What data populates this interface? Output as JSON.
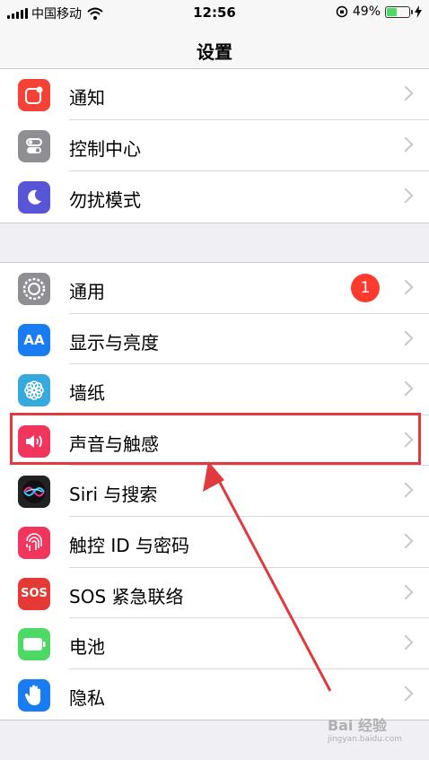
{
  "status_bar": {
    "carrier": "中国移动",
    "time": "12:56",
    "battery_pct": "49%",
    "battery_level": 0.49
  },
  "nav": {
    "title": "设置"
  },
  "group1": [
    {
      "label": "通知",
      "icon": "notifications-icon",
      "color": "#f44336"
    },
    {
      "label": "控制中心",
      "icon": "control-center-icon",
      "color": "#8e8e93"
    },
    {
      "label": "勿扰模式",
      "icon": "moon-icon",
      "color": "#5856d6"
    }
  ],
  "group2": [
    {
      "label": "通用",
      "icon": "gear-icon",
      "color": "#8e8e93",
      "badge": "1"
    },
    {
      "label": "显示与亮度",
      "icon": "display-icon",
      "color": "#1a7cf2",
      "glyph": "AA"
    },
    {
      "label": "墙纸",
      "icon": "wallpaper-icon",
      "color": "#36aadc"
    },
    {
      "label": "声音与触感",
      "icon": "speaker-icon",
      "color": "#f2355c"
    },
    {
      "label": "Siri 与搜索",
      "icon": "siri-icon",
      "color": "#222"
    },
    {
      "label": "触控 ID 与密码",
      "icon": "fingerprint-icon",
      "color": "#f2355c"
    },
    {
      "label": "SOS 紧急联络",
      "icon": "sos-icon",
      "color": "#e53935",
      "glyph": "SOS"
    },
    {
      "label": "电池",
      "icon": "battery-icon",
      "color": "#4cd964"
    },
    {
      "label": "隐私",
      "icon": "hand-icon",
      "color": "#1a7cf2"
    }
  ],
  "annotation_color": "#e0393e",
  "watermark": {
    "main": "Bai 经验",
    "sub": "jingyan.baidu.com"
  }
}
